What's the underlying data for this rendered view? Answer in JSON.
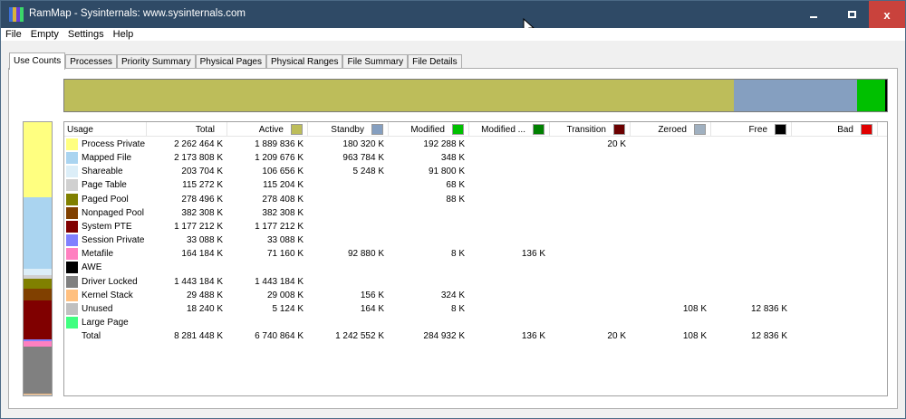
{
  "window": {
    "title": "RamMap - Sysinternals: www.sysinternals.com",
    "icon_colors": [
      "#3b6fd8",
      "#d8b33b",
      "#6a3bd8",
      "#3bd86a"
    ],
    "accent": "#2f4a66",
    "close_color": "#c9423c",
    "controls": {
      "minimize": "minimize-icon",
      "maximize": "maximize-icon",
      "close_label": "x"
    }
  },
  "menu": [
    "File",
    "Empty",
    "Settings",
    "Help"
  ],
  "tabs": [
    "Use Counts",
    "Processes",
    "Priority Summary",
    "Physical Pages",
    "Physical Ranges",
    "File Summary",
    "File Details"
  ],
  "active_tab": "Use Counts",
  "usage_bar": [
    {
      "name": "Active",
      "value": 6740864,
      "color": "#bdbd5a"
    },
    {
      "name": "Standby",
      "value": 1242552,
      "color": "#859fc0"
    },
    {
      "name": "Modified",
      "value": 284932,
      "color": "#00c000"
    },
    {
      "name": "Modified no write",
      "value": 136,
      "color": "#008000"
    },
    {
      "name": "Transition",
      "value": 20,
      "color": "#6b0000"
    },
    {
      "name": "Zeroed",
      "value": 108,
      "color": "#a0b0c0"
    },
    {
      "name": "Free",
      "value": 12836,
      "color": "#000000"
    }
  ],
  "sidebar_colors": [
    "#ffff80",
    "#aad4f0",
    "#dceef8",
    "#d0d0d0",
    "#808000",
    "#804000",
    "#800000",
    "#8080ff",
    "#ff80c0",
    "#000000",
    "#808080",
    "#ffc080",
    "#c0c0c0",
    "#40ff80"
  ],
  "headers": [
    {
      "label": "Usage",
      "color": null
    },
    {
      "label": "Total",
      "color": null
    },
    {
      "label": "Active",
      "color": "#bdbd5a"
    },
    {
      "label": "Standby",
      "color": "#859fc0"
    },
    {
      "label": "Modified",
      "color": "#00c000"
    },
    {
      "label": "Modified ...",
      "color": "#008000"
    },
    {
      "label": "Transition",
      "color": "#6b0000"
    },
    {
      "label": "Zeroed",
      "color": "#a0b0c0"
    },
    {
      "label": "Free",
      "color": "#000000"
    },
    {
      "label": "Bad",
      "color": "#e00000"
    }
  ],
  "rows": [
    {
      "name": "Process Private",
      "color": "#ffff80",
      "kb": 2262464,
      "total": "2 262 464 K",
      "active": "1 889 836 K",
      "standby": "180 320 K",
      "modified": "192 288 K",
      "modified_no_write": "",
      "transition": "20 K",
      "zeroed": "",
      "free": "",
      "bad": ""
    },
    {
      "name": "Mapped File",
      "color": "#aad4f0",
      "kb": 2173808,
      "total": "2 173 808 K",
      "active": "1 209 676 K",
      "standby": "963 784 K",
      "modified": "348 K",
      "modified_no_write": "",
      "transition": "",
      "zeroed": "",
      "free": "",
      "bad": ""
    },
    {
      "name": "Shareable",
      "color": "#dceef8",
      "kb": 203704,
      "total": "203 704 K",
      "active": "106 656 K",
      "standby": "5 248 K",
      "modified": "91 800 K",
      "modified_no_write": "",
      "transition": "",
      "zeroed": "",
      "free": "",
      "bad": ""
    },
    {
      "name": "Page Table",
      "color": "#d0d0d0",
      "kb": 115272,
      "total": "115 272 K",
      "active": "115 204 K",
      "standby": "",
      "modified": "68 K",
      "modified_no_write": "",
      "transition": "",
      "zeroed": "",
      "free": "",
      "bad": ""
    },
    {
      "name": "Paged Pool",
      "color": "#808000",
      "kb": 278496,
      "total": "278 496 K",
      "active": "278 408 K",
      "standby": "",
      "modified": "88 K",
      "modified_no_write": "",
      "transition": "",
      "zeroed": "",
      "free": "",
      "bad": ""
    },
    {
      "name": "Nonpaged Pool",
      "color": "#804000",
      "kb": 382308,
      "total": "382 308 K",
      "active": "382 308 K",
      "standby": "",
      "modified": "",
      "modified_no_write": "",
      "transition": "",
      "zeroed": "",
      "free": "",
      "bad": ""
    },
    {
      "name": "System PTE",
      "color": "#800000",
      "kb": 1177212,
      "total": "1 177 212 K",
      "active": "1 177 212 K",
      "standby": "",
      "modified": "",
      "modified_no_write": "",
      "transition": "",
      "zeroed": "",
      "free": "",
      "bad": ""
    },
    {
      "name": "Session Private",
      "color": "#8080ff",
      "kb": 33088,
      "total": "33 088 K",
      "active": "33 088 K",
      "standby": "",
      "modified": "",
      "modified_no_write": "",
      "transition": "",
      "zeroed": "",
      "free": "",
      "bad": ""
    },
    {
      "name": "Metafile",
      "color": "#ff80c0",
      "kb": 164184,
      "total": "164 184 K",
      "active": "71 160 K",
      "standby": "92 880 K",
      "modified": "8 K",
      "modified_no_write": "136 K",
      "transition": "",
      "zeroed": "",
      "free": "",
      "bad": ""
    },
    {
      "name": "AWE",
      "color": "#000000",
      "kb": 0,
      "total": "",
      "active": "",
      "standby": "",
      "modified": "",
      "modified_no_write": "",
      "transition": "",
      "zeroed": "",
      "free": "",
      "bad": ""
    },
    {
      "name": "Driver Locked",
      "color": "#808080",
      "kb": 1443184,
      "total": "1 443 184 K",
      "active": "1 443 184 K",
      "standby": "",
      "modified": "",
      "modified_no_write": "",
      "transition": "",
      "zeroed": "",
      "free": "",
      "bad": ""
    },
    {
      "name": "Kernel Stack",
      "color": "#ffc080",
      "kb": 29488,
      "total": "29 488 K",
      "active": "29 008 K",
      "standby": "156 K",
      "modified": "324 K",
      "modified_no_write": "",
      "transition": "",
      "zeroed": "",
      "free": "",
      "bad": ""
    },
    {
      "name": "Unused",
      "color": "#c0c0c0",
      "kb": 18240,
      "total": "18 240 K",
      "active": "5 124 K",
      "standby": "164 K",
      "modified": "8 K",
      "modified_no_write": "",
      "transition": "",
      "zeroed": "108 K",
      "free": "12 836 K",
      "bad": ""
    },
    {
      "name": "Large Page",
      "color": "#40ff80",
      "kb": 0,
      "total": "",
      "active": "",
      "standby": "",
      "modified": "",
      "modified_no_write": "",
      "transition": "",
      "zeroed": "",
      "free": "",
      "bad": ""
    },
    {
      "name": "Total",
      "color": null,
      "kb": 0,
      "total": "8 281 448 K",
      "active": "6 740 864 K",
      "standby": "1 242 552 K",
      "modified": "284 932 K",
      "modified_no_write": "136 K",
      "transition": "20 K",
      "zeroed": "108 K",
      "free": "12 836 K",
      "bad": ""
    }
  ]
}
